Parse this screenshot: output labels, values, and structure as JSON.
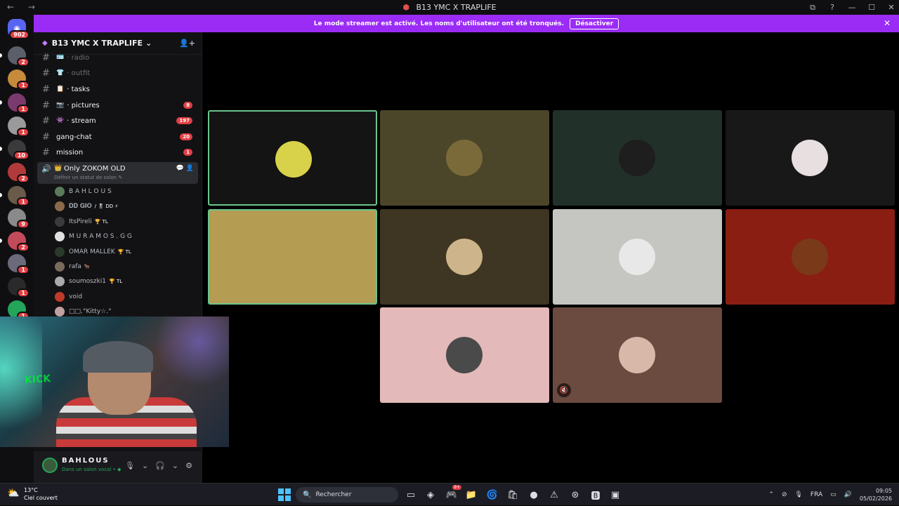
{
  "window": {
    "title": "B13 YMC X TRAPLIFE",
    "nav_back": "←",
    "nav_forward": "→",
    "controls": [
      "⧉",
      "?",
      "—",
      "☐",
      "✕"
    ]
  },
  "banner": {
    "text": "Le mode streamer est activé. Les noms d'utilisateur ont été tronqués.",
    "button": "Désactiver",
    "close": "✕"
  },
  "rail": {
    "home_badge": "902",
    "servers": [
      {
        "badge": "2",
        "color": "#5a5f6b"
      },
      {
        "badge": "1",
        "color": "#c58a3a"
      },
      {
        "badge": "1",
        "color": "#7b3a6e"
      },
      {
        "badge": "1",
        "color": "#9a9a9a"
      },
      {
        "badge": "10",
        "color": "#3a3a3a"
      },
      {
        "badge": "2",
        "color": "#b33a3a"
      },
      {
        "badge": "1",
        "color": "#6a5a4a"
      },
      {
        "badge": "9",
        "color": "#8a8a8a"
      },
      {
        "badge": "2",
        "color": "#c24a5a"
      },
      {
        "badge": "1",
        "color": "#6a6a7a"
      },
      {
        "badge": "1",
        "color": "#2a2a2a"
      },
      {
        "badge": "1",
        "color": "#23a55a"
      }
    ]
  },
  "guild": {
    "name": "B13 YMC X TRAPLIFE",
    "chevron": "⌄",
    "invite_icon": "👤+"
  },
  "channels": [
    {
      "emoji": "🪪",
      "name": "· radio",
      "count": "",
      "dim": true
    },
    {
      "emoji": "👕",
      "name": "· outfit",
      "count": "",
      "dim": true
    },
    {
      "emoji": "📋",
      "name": "· tasks",
      "count": "",
      "dim": false
    },
    {
      "emoji": "📷",
      "name": "· pictures",
      "count": "8",
      "dim": false
    },
    {
      "emoji": "👾",
      "name": "· stream",
      "count": "197",
      "dim": false
    },
    {
      "emoji": "",
      "name": "gang-chat",
      "count": "20",
      "dim": false
    },
    {
      "emoji": "",
      "name": "mission",
      "count": "1",
      "dim": false
    }
  ],
  "voice_channel": {
    "name": "Only ZOKOM OLD",
    "prefix": "👑 ·",
    "status": "Définir un statut de salon ✎"
  },
  "members": [
    {
      "name": "B A H L O U S",
      "tag": "",
      "color": "#5a7a5a"
    },
    {
      "name": "𝐃𝐃 𝐆𝐈𝐎",
      "tag": "/ 🎖 DD ⚡",
      "color": "#8a6a4a"
    },
    {
      "name": "ItsPireli",
      "tag": "🏆 TL",
      "color": "#3a3a3a"
    },
    {
      "name": "M U R A M O S . G G",
      "tag": "",
      "color": "#e0e0e0"
    },
    {
      "name": "OMAR MALLEK",
      "tag": "🏆 TL",
      "color": "#2a3a2a"
    },
    {
      "name": "rafa",
      "tag": "🐂",
      "color": "#7a6a5a"
    },
    {
      "name": "soumoszki1",
      "tag": "🏆 TL",
      "color": "#aaaaaa"
    },
    {
      "name": "void",
      "tag": "",
      "color": "#c03a2a"
    },
    {
      "name": "□□.°Kitty☆.°",
      "tag": "",
      "color": "#c0a0a0"
    }
  ],
  "user_panel": {
    "name": "BAHLOUS",
    "status": "Dans un salon vocal • ◆",
    "mic": "🎙",
    "headset": "🎧",
    "settings": "⚙"
  },
  "tiles": [
    {
      "bg": "#141414",
      "av": "#d8d24a",
      "active": true,
      "muted": false
    },
    {
      "bg": "#4b4629",
      "av": "#7a6a3a",
      "active": false,
      "muted": false
    },
    {
      "bg": "#22302a",
      "av": "#1e1e1e",
      "active": false,
      "muted": false
    },
    {
      "bg": "#181818",
      "av": "#e8e0e0",
      "active": false,
      "muted": false
    },
    {
      "bg": "#b49c52",
      "av": "#b49c52",
      "active": true,
      "muted": false
    },
    {
      "bg": "#3e3522",
      "av": "#cdb48a",
      "active": false,
      "muted": false
    },
    {
      "bg": "#c5c5c1",
      "av": "#e8e8e8",
      "active": false,
      "muted": false
    },
    {
      "bg": "#8a1e12",
      "av": "#7a3a1a",
      "active": false,
      "muted": false
    },
    {
      "bg": "#e3b9b9",
      "av": "#4a4a4a",
      "active": false,
      "muted": false
    },
    {
      "bg": "#6b4a40",
      "av": "#d8b8a8",
      "active": false,
      "muted": true
    }
  ],
  "taskbar": {
    "temp": "13°C",
    "weather": "Ciel couvert",
    "search": "Rechercher",
    "apps": [
      "▭",
      "◈",
      "🎮",
      "📁",
      "🌀",
      "🛍",
      "●",
      "⚠",
      "⊛",
      "🅱",
      "▣"
    ],
    "discord_badge": "9+",
    "lang": "FRA",
    "time": "09:05",
    "date": "05/02/2026"
  }
}
